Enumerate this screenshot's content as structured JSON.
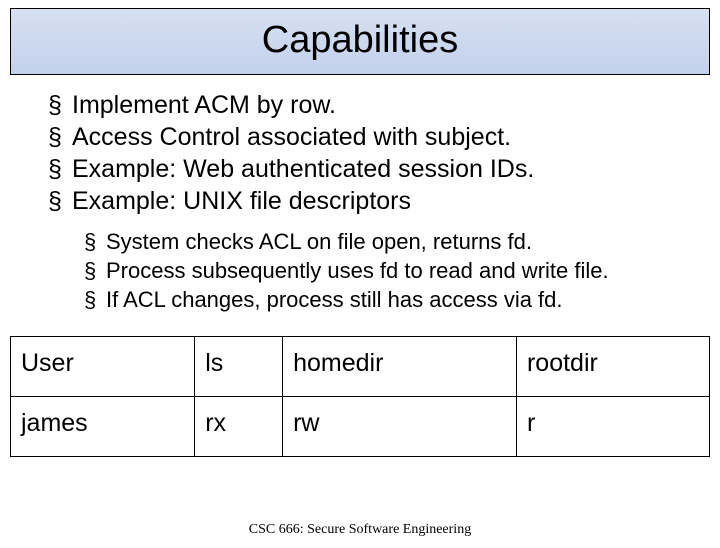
{
  "title": "Capabilities",
  "bullets": [
    "Implement ACM by row.",
    "Access Control associated with subject.",
    "Example: Web authenticated session IDs.",
    "Example: UNIX file descriptors"
  ],
  "subbullets": [
    "System checks ACL on file open, returns fd.",
    "Process subsequently uses fd to read and write file.",
    "If ACL changes, process still has access via fd."
  ],
  "table": {
    "header": [
      "User",
      "ls",
      "homedir",
      "rootdir"
    ],
    "row": [
      "james",
      "rx",
      "rw",
      "r"
    ]
  },
  "footer": "CSC 666: Secure Software Engineering"
}
